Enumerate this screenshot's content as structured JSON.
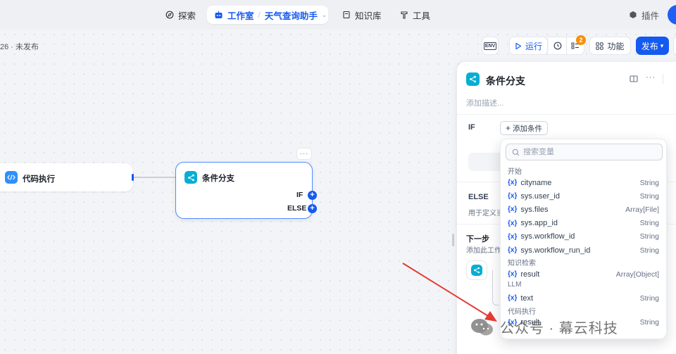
{
  "nav": {
    "explore": "探索",
    "studio": "工作室",
    "app_name": "天气查询助手",
    "knowledge": "知识库",
    "tools": "工具",
    "plugins": "插件"
  },
  "version_status": "26 · 未发布",
  "toolbar": {
    "env": "ENV",
    "run": "运行",
    "checklist_count": "2",
    "features": "功能",
    "publish": "发布"
  },
  "canvas": {
    "code_node_title": "代码执行",
    "branch_node_title": "条件分支",
    "port_if": "IF",
    "port_else": "ELSE",
    "more": "···"
  },
  "panel": {
    "title": "条件分支",
    "desc_placeholder": "添加描述...",
    "if_label": "IF",
    "add_condition": "添加条件",
    "else_label": "ELSE",
    "else_desc": "用于定义当",
    "next_step": "下一步",
    "next_desc": "添加此工作"
  },
  "dropdown": {
    "search_placeholder": "搜索变量",
    "groups": [
      {
        "name": "开始",
        "vars": [
          {
            "name": "cityname",
            "type": "String"
          },
          {
            "name": "sys.user_id",
            "type": "String"
          },
          {
            "name": "sys.files",
            "type": "Array[File]"
          },
          {
            "name": "sys.app_id",
            "type": "String"
          },
          {
            "name": "sys.workflow_id",
            "type": "String"
          },
          {
            "name": "sys.workflow_run_id",
            "type": "String"
          }
        ]
      },
      {
        "name": "知识检索",
        "vars": [
          {
            "name": "result",
            "type": "Array[Object]"
          }
        ]
      },
      {
        "name": "LLM",
        "vars": [
          {
            "name": "text",
            "type": "String"
          }
        ]
      },
      {
        "name": "代码执行",
        "vars": [
          {
            "name": "result",
            "type": "String"
          }
        ]
      }
    ]
  },
  "watermark": "公众号 · 幕云科技",
  "colors": {
    "primary": "#155aef",
    "warning": "#f79009",
    "arrow": "#e53935"
  }
}
